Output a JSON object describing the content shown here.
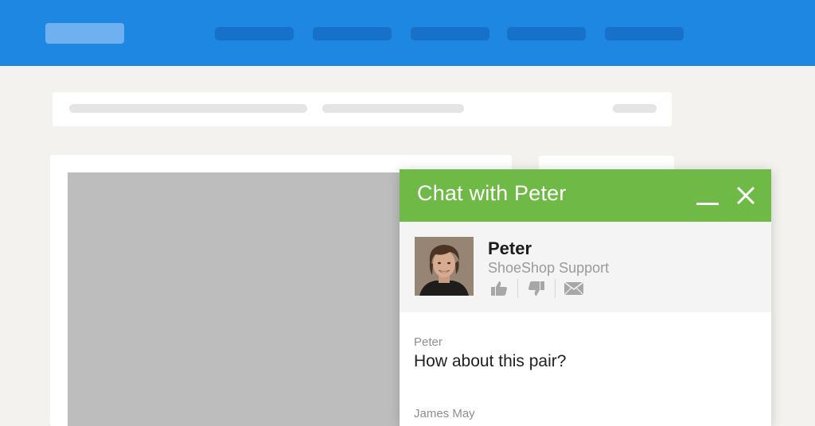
{
  "chat": {
    "title": "Chat with Peter",
    "agent": {
      "name": "Peter",
      "role": "ShoeShop Support"
    },
    "messages": [
      {
        "author": "Peter",
        "text": "How about this pair?"
      },
      {
        "author": "James May",
        "text": ""
      }
    ],
    "icons": {
      "minimize": "minimize-icon",
      "close": "close-icon",
      "thumbs_up": "thumbs-up-icon",
      "thumbs_down": "thumbs-down-icon",
      "email": "envelope-icon"
    }
  },
  "colors": {
    "nav_bar": "#1e87e2",
    "chat_header": "#6fba46",
    "page_background": "#f3f2ef"
  }
}
